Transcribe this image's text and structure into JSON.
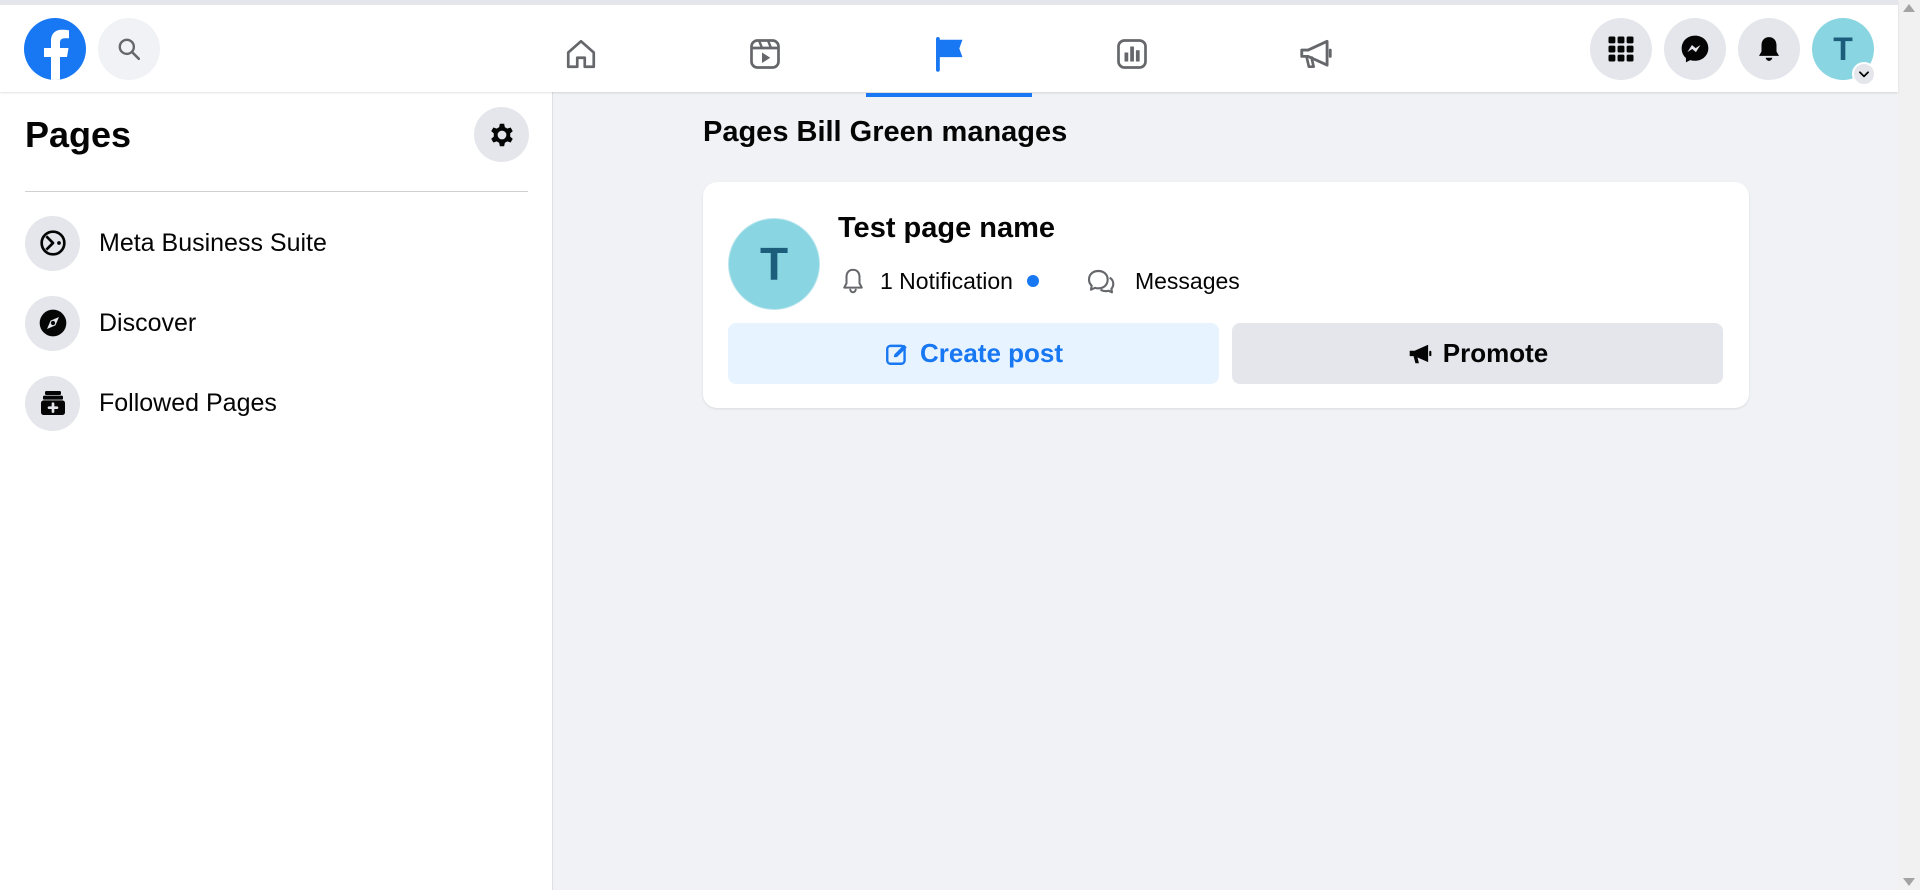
{
  "colors": {
    "brand": "#1877f2",
    "page_background": "#f0f2f5",
    "avatar": "#8ad5e2"
  },
  "topbar": {
    "nav_tabs": [
      {
        "icon": "home-icon",
        "active": false
      },
      {
        "icon": "video-icon",
        "active": false
      },
      {
        "icon": "flag-icon",
        "active": true
      },
      {
        "icon": "insights-icon",
        "active": false
      },
      {
        "icon": "megaphone-icon",
        "active": false
      }
    ],
    "right_icons": [
      "menu-grid-icon",
      "messenger-icon",
      "bell-icon"
    ],
    "avatar_initial": "T"
  },
  "sidebar": {
    "title": "Pages",
    "items": [
      {
        "label": "Meta Business Suite",
        "icon": "business-suite-icon"
      },
      {
        "label": "Discover",
        "icon": "compass-icon"
      },
      {
        "label": "Followed Pages",
        "icon": "followed-pages-icon"
      }
    ]
  },
  "main": {
    "heading": "Pages Bill Green manages",
    "page_card": {
      "avatar_initial": "T",
      "page_name": "Test page name",
      "notification_text": "1 Notification",
      "messages_text": "Messages",
      "create_post_label": "Create post",
      "promote_label": "Promote"
    }
  }
}
